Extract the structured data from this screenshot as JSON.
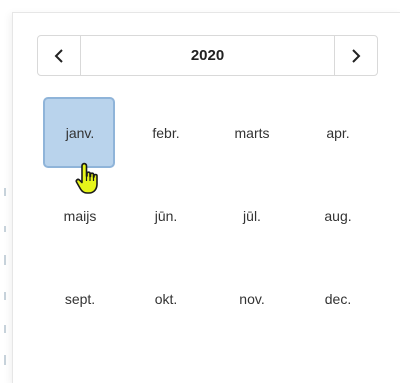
{
  "header": {
    "year": "2020",
    "prev_icon": "chevron-left-icon",
    "next_icon": "chevron-right-icon"
  },
  "months": [
    {
      "label": "janv.",
      "selected": true
    },
    {
      "label": "febr.",
      "selected": false
    },
    {
      "label": "marts",
      "selected": false
    },
    {
      "label": "apr.",
      "selected": false
    },
    {
      "label": "maijs",
      "selected": false
    },
    {
      "label": "jūn.",
      "selected": false
    },
    {
      "label": "jūl.",
      "selected": false
    },
    {
      "label": "aug.",
      "selected": false
    },
    {
      "label": "sept.",
      "selected": false
    },
    {
      "label": "okt.",
      "selected": false
    },
    {
      "label": "nov.",
      "selected": false
    },
    {
      "label": "dec.",
      "selected": false
    }
  ],
  "colors": {
    "selected_fill": "#b9d3ec",
    "selected_border": "#8fb4d9",
    "cursor": "#e6f51a"
  },
  "cursor_icon": "hand-pointer-icon"
}
